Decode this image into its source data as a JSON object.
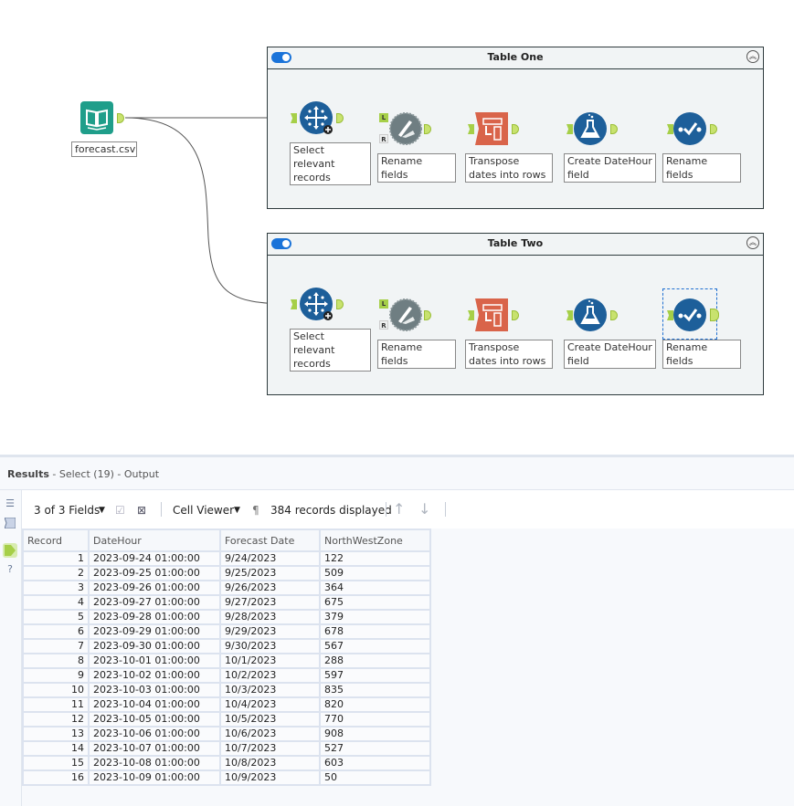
{
  "canvas": {
    "input_tool": {
      "label": "forecast.csv",
      "icon": "book-icon"
    },
    "containers": [
      {
        "title": "Table One",
        "tools": [
          {
            "label": "Select relevant records",
            "icon": "select-records-icon"
          },
          {
            "label": "Rename fields",
            "icon": "formula-pen-icon",
            "anchors": [
              "L",
              "R"
            ]
          },
          {
            "label": "Transpose dates into rows",
            "icon": "transpose-icon"
          },
          {
            "label": "Create DateHour field",
            "icon": "flask-icon"
          },
          {
            "label": "Rename fields",
            "icon": "select-check-icon"
          }
        ]
      },
      {
        "title": "Table Two",
        "tools": [
          {
            "label": "Select relevant records",
            "icon": "select-records-icon"
          },
          {
            "label": "Rename fields",
            "icon": "formula-pen-icon",
            "anchors": [
              "L",
              "R"
            ]
          },
          {
            "label": "Transpose dates into rows",
            "icon": "transpose-icon"
          },
          {
            "label": "Create DateHour field",
            "icon": "flask-icon"
          },
          {
            "label": "Rename fields",
            "icon": "select-check-icon",
            "selected": true
          }
        ]
      }
    ],
    "anchor_labels": {
      "left": "L",
      "right": "R"
    }
  },
  "results": {
    "title": "Results",
    "subtitle": " - Select (19) - Output",
    "toolbar": {
      "fields": "3 of 3 Fields",
      "cell_viewer": "Cell Viewer",
      "pilcrow": "¶",
      "records": "384 records displayed"
    },
    "columns": [
      "Record",
      "DateHour",
      "Forecast Date",
      "NorthWestZone"
    ],
    "rows": [
      [
        "1",
        "2023-09-24 01:00:00",
        "9/24/2023",
        "122"
      ],
      [
        "2",
        "2023-09-25 01:00:00",
        "9/25/2023",
        "509"
      ],
      [
        "3",
        "2023-09-26 01:00:00",
        "9/26/2023",
        "364"
      ],
      [
        "4",
        "2023-09-27 01:00:00",
        "9/27/2023",
        "675"
      ],
      [
        "5",
        "2023-09-28 01:00:00",
        "9/28/2023",
        "379"
      ],
      [
        "6",
        "2023-09-29 01:00:00",
        "9/29/2023",
        "678"
      ],
      [
        "7",
        "2023-09-30 01:00:00",
        "9/30/2023",
        "567"
      ],
      [
        "8",
        "2023-10-01 01:00:00",
        "10/1/2023",
        "288"
      ],
      [
        "9",
        "2023-10-02 01:00:00",
        "10/2/2023",
        "597"
      ],
      [
        "10",
        "2023-10-03 01:00:00",
        "10/3/2023",
        "835"
      ],
      [
        "11",
        "2023-10-04 01:00:00",
        "10/4/2023",
        "820"
      ],
      [
        "12",
        "2023-10-05 01:00:00",
        "10/5/2023",
        "770"
      ],
      [
        "13",
        "2023-10-06 01:00:00",
        "10/6/2023",
        "908"
      ],
      [
        "14",
        "2023-10-07 01:00:00",
        "10/7/2023",
        "527"
      ],
      [
        "15",
        "2023-10-08 01:00:00",
        "10/8/2023",
        "603"
      ],
      [
        "16",
        "2023-10-09 01:00:00",
        "10/9/2023",
        "50"
      ]
    ]
  }
}
